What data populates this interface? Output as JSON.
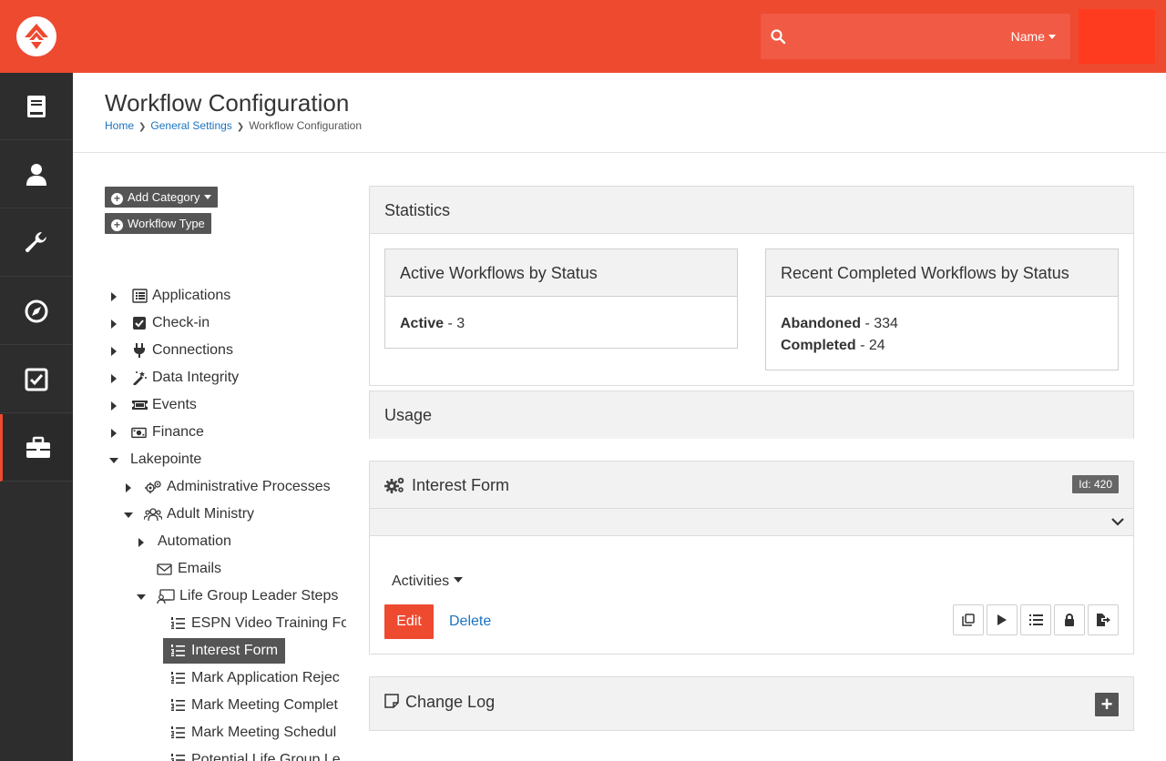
{
  "header": {
    "search_filter": "Name"
  },
  "page": {
    "title": "Workflow Configuration",
    "breadcrumb": [
      "Home",
      "General Settings",
      "Workflow Configuration"
    ]
  },
  "left_nav": {
    "icons": [
      "book-icon",
      "user-icon",
      "wrench-icon",
      "compass-icon",
      "checkbox-icon",
      "briefcase-icon"
    ],
    "active": "briefcase-icon"
  },
  "actions": {
    "add_category": "Add Category",
    "workflow_type": "Workflow Type"
  },
  "tree": [
    {
      "label": "Applications",
      "icon": "list-icon",
      "state": "closed"
    },
    {
      "label": "Check-in",
      "icon": "check-square-icon",
      "state": "closed"
    },
    {
      "label": "Connections",
      "icon": "plug-icon",
      "state": "closed"
    },
    {
      "label": "Data Integrity",
      "icon": "magic-wand-icon",
      "state": "closed"
    },
    {
      "label": "Events",
      "icon": "ticket-icon",
      "state": "closed"
    },
    {
      "label": "Finance",
      "icon": "money-icon",
      "state": "closed"
    },
    {
      "label": "Lakepointe",
      "icon": "",
      "state": "open"
    },
    {
      "label": "Administrative Processes",
      "icon": "cogs-icon",
      "state": "closed"
    },
    {
      "label": "Adult Ministry",
      "icon": "users-icon",
      "state": "open"
    },
    {
      "label": "Automation",
      "icon": "",
      "state": "closed"
    },
    {
      "label": "Emails",
      "icon": "envelope-icon",
      "state": "none"
    },
    {
      "label": "Life Group Leader Steps",
      "icon": "chalkboard-icon",
      "state": "open"
    },
    {
      "label": "ESPN Video Training Fo",
      "icon": "list-ol-icon",
      "state": "none"
    },
    {
      "label": "Interest Form",
      "icon": "list-ol-icon",
      "state": "none",
      "selected": true
    },
    {
      "label": "Mark Application Rejec",
      "icon": "list-ol-icon",
      "state": "none"
    },
    {
      "label": "Mark Meeting Complet",
      "icon": "list-ol-icon",
      "state": "none"
    },
    {
      "label": "Mark Meeting Schedul",
      "icon": "list-ol-icon",
      "state": "none"
    },
    {
      "label": "Potential Life Group Le",
      "icon": "list-ol-icon",
      "state": "none"
    }
  ],
  "statistics": {
    "title": "Statistics",
    "active": {
      "title": "Active Workflows by Status",
      "rows": [
        {
          "status": "Active",
          "count": "- 3"
        }
      ]
    },
    "completed": {
      "title": "Recent Completed Workflows by Status",
      "rows": [
        {
          "status": "Abandoned",
          "count": "- 334"
        },
        {
          "status": "Completed",
          "count": "- 24"
        }
      ]
    }
  },
  "usage": {
    "title": "Usage"
  },
  "workflow": {
    "title": "Interest Form",
    "id_badge": "Id: 420",
    "activities_label": "Activities",
    "edit_label": "Edit",
    "delete_label": "Delete",
    "tool_buttons": [
      "copy-icon",
      "play-icon",
      "list-icon",
      "lock-icon",
      "export-icon"
    ]
  },
  "change_log": {
    "title": "Change Log"
  },
  "colors": {
    "brand": "#ee4a30",
    "nav_bg": "#2d2d2d",
    "link": "#1b73c1"
  }
}
